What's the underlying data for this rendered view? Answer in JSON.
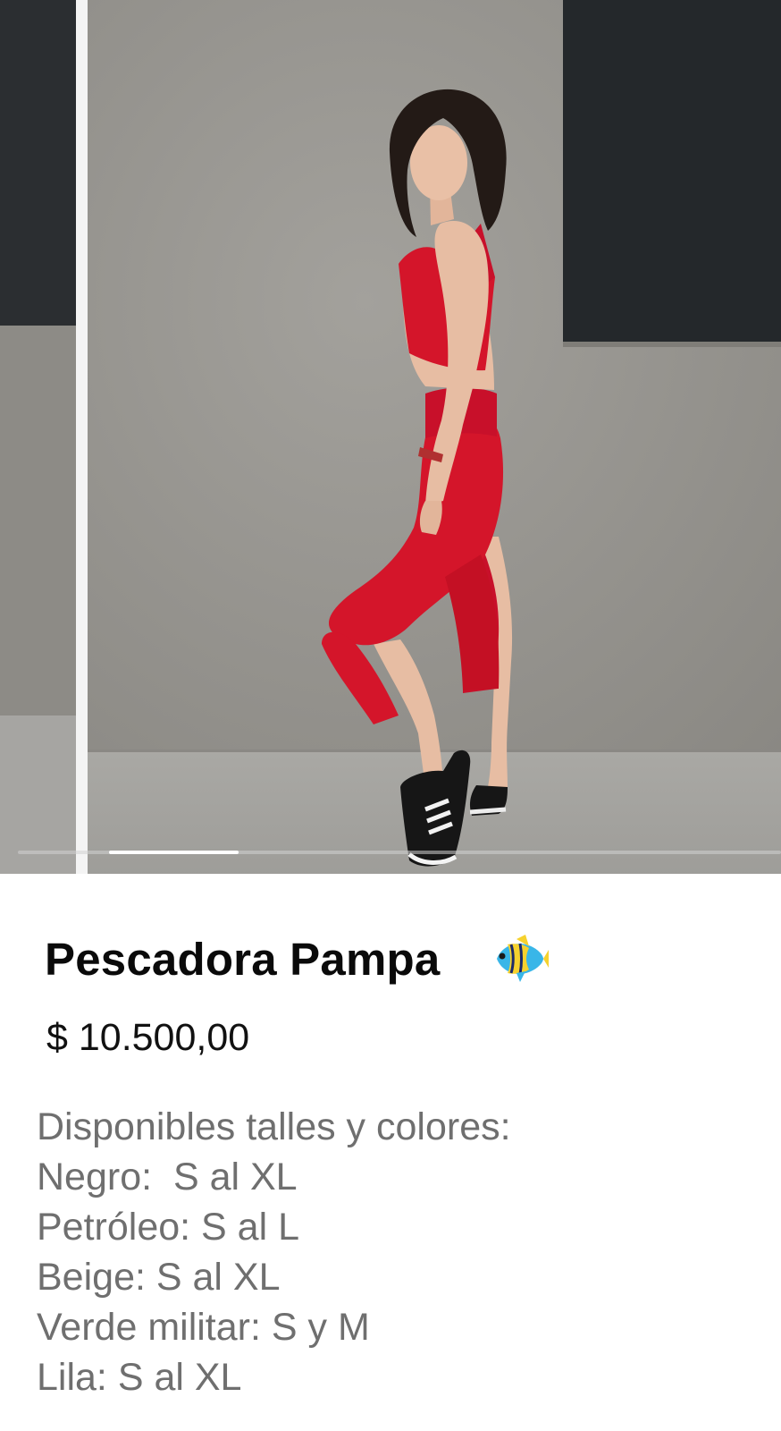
{
  "carousel": {
    "current_slide_fraction": 0.17,
    "colors": {
      "wall": "#96948f",
      "dark_panel": "#24282b",
      "floor": "#a6a5a2",
      "outfit": "#d4152a"
    }
  },
  "product": {
    "title": "Pescadora Pampa",
    "title_icon": "tropical-fish-icon",
    "price": "$ 10.500,00",
    "description_lines": [
      "Disponibles talles y colores:",
      "Negro:  S al XL",
      "Petróleo: S al L",
      "Beige: S al XL",
      "Verde militar: S y M",
      "Lila: S al XL"
    ]
  }
}
